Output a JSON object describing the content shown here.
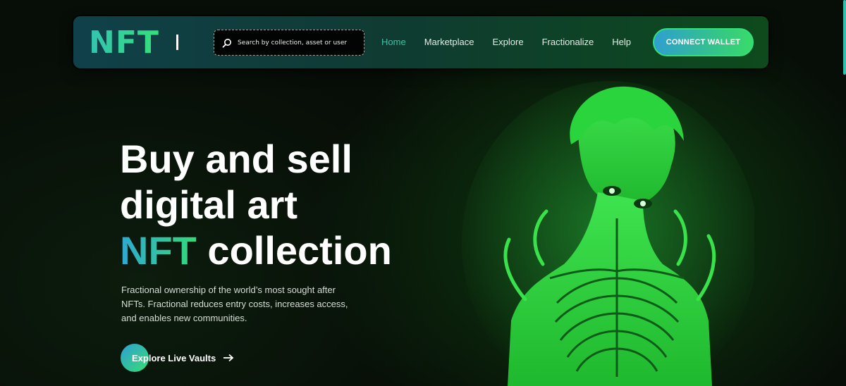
{
  "brand": {
    "logo_text": "NFT"
  },
  "search": {
    "placeholder": "Search by collection, asset or user"
  },
  "nav": {
    "items": [
      {
        "label": "Home",
        "active": true
      },
      {
        "label": "Marketplace",
        "active": false
      },
      {
        "label": "Explore",
        "active": false
      },
      {
        "label": "Fractionalize",
        "active": false
      },
      {
        "label": "Help",
        "active": false
      }
    ],
    "connect_label": "CONNECT WALLET"
  },
  "hero": {
    "title_line1": "Buy and sell",
    "title_line2": "digital art",
    "title_accent": "NFT",
    "title_line3_rest": " collection",
    "description": "Fractional ownership of the world’s most sought after NFTs. Fractional reduces entry costs, increases access, and enables new communities.",
    "cta_label": "Explore Live Vaults"
  },
  "colors": {
    "accent_teal": "#36c6a4",
    "accent_green": "#34e07a",
    "accent_blue": "#2fa8d2",
    "art_glow": "#2ee04a",
    "background": "#060b06"
  },
  "icons": {
    "search": "search-icon",
    "cta_arrow": "arrow-right-icon",
    "art": "green-skeleton-figure"
  }
}
